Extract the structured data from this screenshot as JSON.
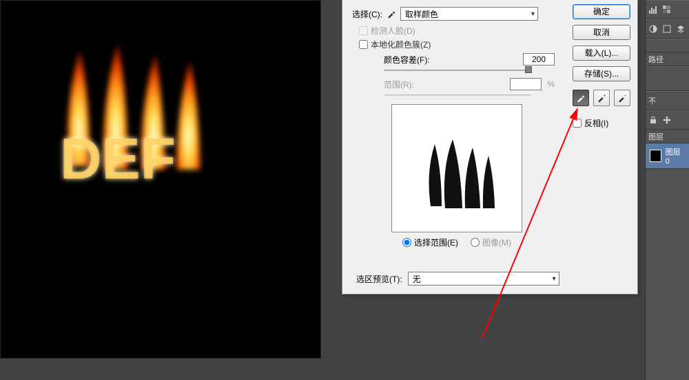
{
  "dialog": {
    "select_label": "选择(C):",
    "select_value": "取样颜色",
    "detect_faces": "检测人脸(D)",
    "localized": "本地化颜色簇(Z)",
    "fuzziness_label": "颜色容差(F):",
    "fuzziness_value": "200",
    "range_label": "范围(R):",
    "range_value": "",
    "range_unit": "%",
    "radio_selection": "选择范围(E)",
    "radio_image": "图像(M)",
    "preview_label": "选区预览(T):",
    "preview_value": "无"
  },
  "buttons": {
    "ok": "确定",
    "cancel": "取消",
    "load": "载入(L)...",
    "save": "存储(S)..."
  },
  "invert_label": "反相(I)",
  "right_panel": {
    "paths_tab": "路径",
    "opacity_marker": "不",
    "layers_tab": "图层",
    "layer_name": "图层 0"
  },
  "canvas_text": "DEF"
}
